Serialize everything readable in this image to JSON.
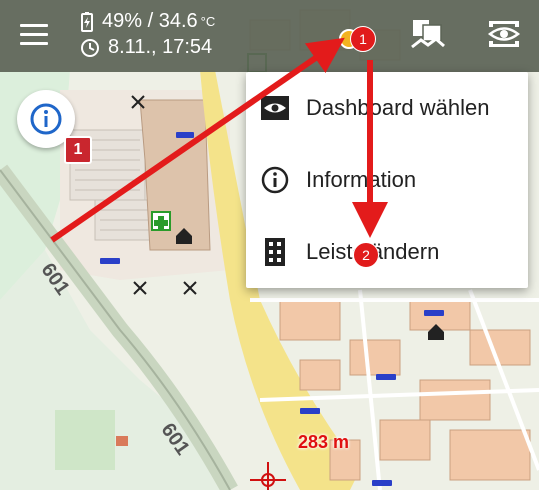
{
  "status": {
    "battery": "49%",
    "separator": "/",
    "temperature": "34.6",
    "temperature_unit": "°C",
    "date": "8.11.,",
    "time": "17:54"
  },
  "toolbar": {
    "menu_icon": "hamburger-icon",
    "map_icon": "map-stack-icon",
    "visibility_icon": "eye-icon"
  },
  "info_fab": {
    "icon": "info-circle-icon"
  },
  "map": {
    "badge_label": "1",
    "route_label_1": "601",
    "route_label_2": "601",
    "distance": "283 m"
  },
  "menu": {
    "items": [
      {
        "label": "Dashboard wählen",
        "icon": "dashboard-eye-icon"
      },
      {
        "label": "Information",
        "icon": "info-circle-icon"
      },
      {
        "label": "Leiste ändern",
        "icon": "bar-layout-icon"
      }
    ]
  },
  "annotations": {
    "step1": "1",
    "step2": "2",
    "arrow_color": "#e31b1b"
  },
  "colors": {
    "topbar": "#5c6456",
    "water_green": "#dff1df",
    "road_yellow": "#f5e27a",
    "building": "#f2c8a8"
  }
}
